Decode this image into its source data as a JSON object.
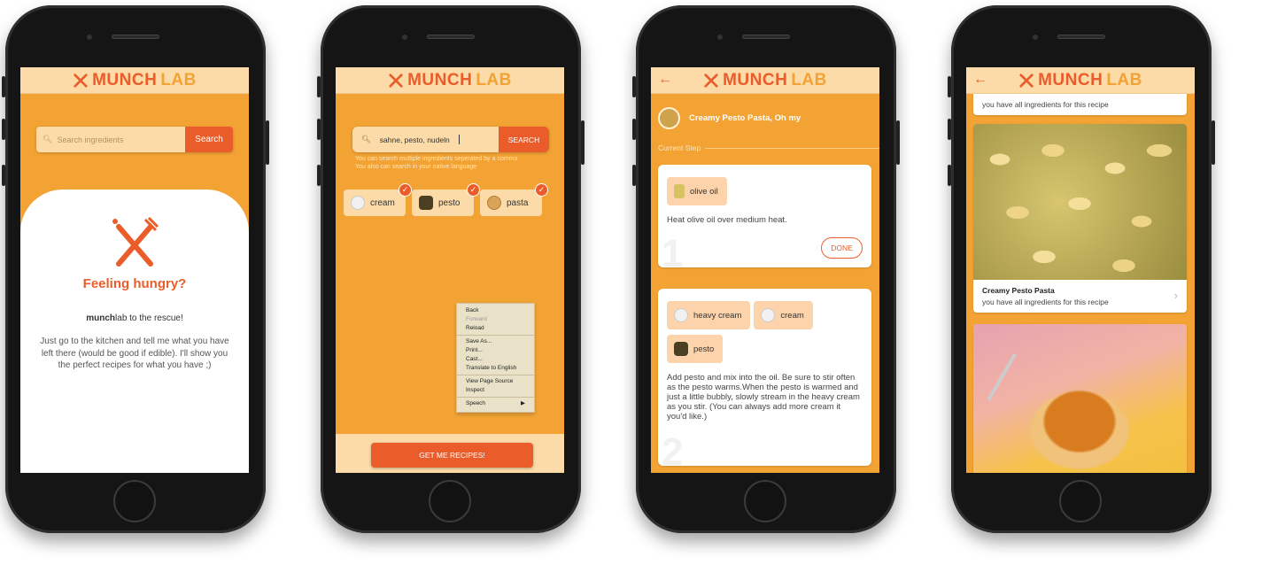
{
  "brand": {
    "munch": "MUNCH",
    "lab": "LAB"
  },
  "screen1": {
    "search_placeholder": "Search ingredients",
    "search_button": "Search",
    "heading": "Feeling hungry?",
    "rescue_bold": "munch",
    "rescue_rest": "lab to the rescue!",
    "description": "Just go to the kitchen and tell me what you have left there (would be good if edible). I'll show you the perfect recipes for what you have ;)"
  },
  "screen2": {
    "search_value": "sahne, pesto, nudeln",
    "search_button": "SEARCH",
    "hint_line1": "You can search multiple ingredients seperated by a comma",
    "hint_line2": "You also can search in your native language",
    "chips": [
      {
        "label": "cream",
        "icon": "cream-icon"
      },
      {
        "label": "pesto",
        "icon": "pesto-icon"
      },
      {
        "label": "pasta",
        "icon": "pasta-icon"
      }
    ],
    "context_menu": {
      "back": "Back",
      "forward": "Forward",
      "reload": "Reload",
      "save_as": "Save As...",
      "print": "Print...",
      "cast": "Cast...",
      "translate": "Translate to English",
      "view_source": "View Page Source",
      "inspect": "Inspect",
      "speech": "Speech"
    },
    "cta": "GET ME RECIPES!"
  },
  "screen3": {
    "back_icon": "←",
    "recipe_title": "Creamy Pesto Pasta, Oh my",
    "current_step": "Current Step",
    "step1": {
      "ingredients": [
        "olive oil"
      ],
      "text": "Heat olive oil over medium heat.",
      "done": "DONE",
      "number": "1"
    },
    "step2": {
      "ingredients": [
        "heavy cream",
        "cream",
        "pesto"
      ],
      "text": "Add pesto and mix into the oil. Be sure to stir often as the pesto warms.When the pesto is warmed and just a little bubbly, slowly stream in the heavy cream as you stir. (You can always add more cream it you'd like.)",
      "number": "2"
    }
  },
  "screen4": {
    "back_icon": "←",
    "top_card_subtitle": "you have all ingredients for this recipe",
    "card1": {
      "title": "Creamy Pesto Pasta",
      "subtitle": "you have all ingredients for this recipe"
    }
  },
  "colors": {
    "orange": "#f2a334",
    "accent": "#ea5d2a",
    "light": "#fcdba8"
  }
}
